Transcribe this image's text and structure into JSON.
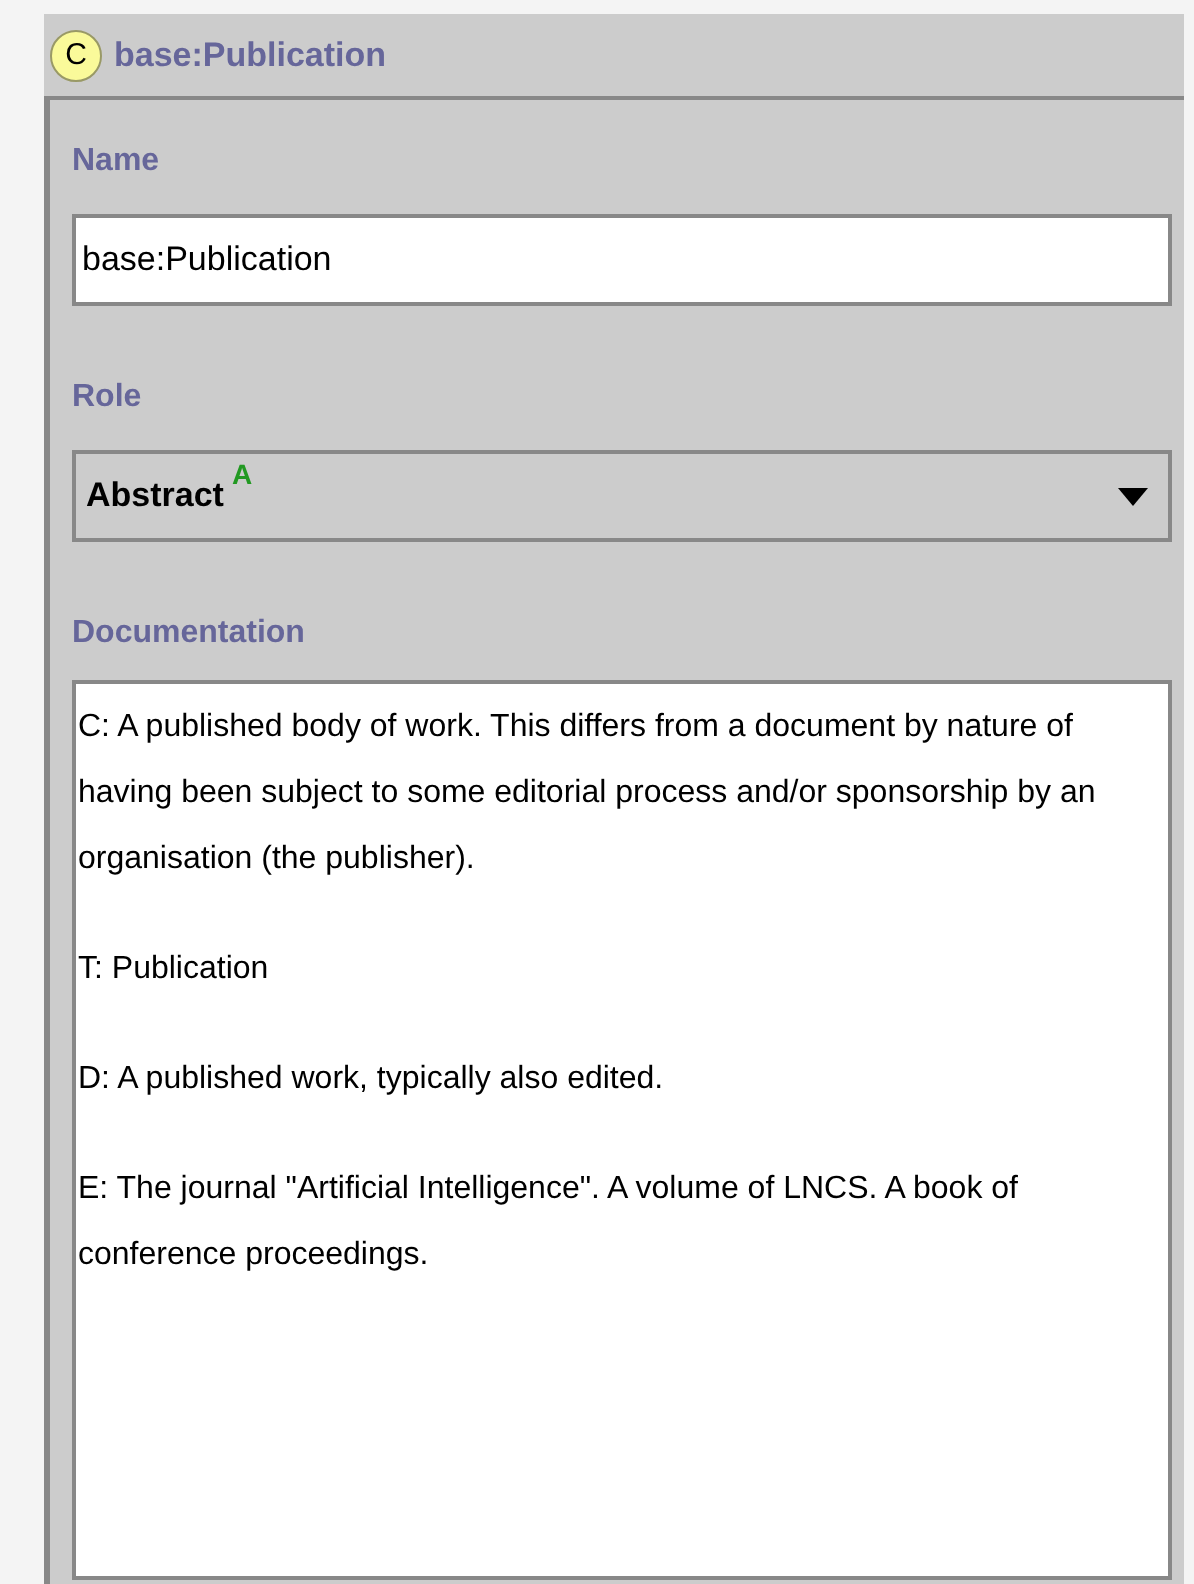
{
  "header": {
    "badge": "C",
    "title": "base:Publication"
  },
  "name": {
    "label": "Name",
    "value": "base:Publication"
  },
  "role": {
    "label": "Role",
    "value": "Abstract",
    "badge": "A"
  },
  "documentation": {
    "label": "Documentation",
    "paragraphs": [
      "C: A published body of work. This differs from a document by nature of having been subject to some editorial process and/or sponsorship by an organisation (the publisher).",
      "T: Publication",
      "D: A published work, typically also edited.",
      "E: The journal \"Artificial Intelligence\". A volume of LNCS. A book of conference proceedings."
    ]
  }
}
